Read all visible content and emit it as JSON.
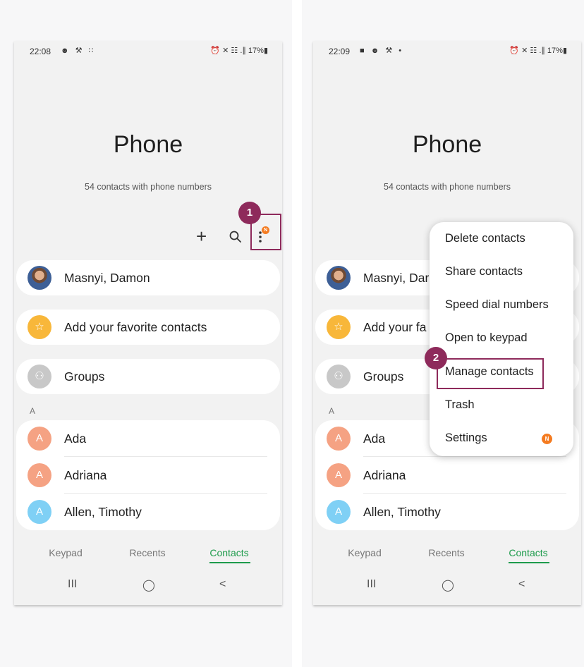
{
  "panels": [
    {
      "status": {
        "time": "22:08",
        "icons": "☻ ⚒ ∷",
        "right": "⏰ ✕ ☷ .∥ 17%▮"
      },
      "title": "Phone",
      "subtitle": "54 contacts with phone numbers",
      "callout": "1",
      "menu_badge": "N"
    },
    {
      "status": {
        "time": "22:09",
        "icons": "■ ☻ ⚒ •",
        "right": "⏰ ✕ ☷ .∥ 17%▮"
      },
      "title": "Phone",
      "subtitle": "54 contacts with phone numbers",
      "callout": "2",
      "menu": {
        "items": [
          "Delete contacts",
          "Share contacts",
          "Speed dial numbers",
          "Open to keypad",
          "Manage contacts",
          "Trash",
          "Settings"
        ],
        "settings_badge": "N"
      }
    }
  ],
  "profile": {
    "name": "Masnyi, Damon",
    "truncated_name": "Masnyi, Dar"
  },
  "favorites": {
    "label": "Add your favorite contacts",
    "truncated_label": "Add your fa"
  },
  "groups": {
    "label": "Groups"
  },
  "section_letter": "A",
  "contacts": [
    {
      "initial": "A",
      "name": "Ada",
      "color": "#f5a283"
    },
    {
      "initial": "A",
      "name": "Adriana",
      "color": "#f5a283"
    },
    {
      "initial": "A",
      "name": "Allen, Timothy",
      "color": "#7fd0f5"
    }
  ],
  "tabs": [
    "Keypad",
    "Recents",
    "Contacts"
  ],
  "active_tab": "Contacts",
  "accent_color": "#1e9b4c",
  "callout_color": "#8e2a5b",
  "nav": {
    "recents": "III",
    "home": "◯",
    "back": "<"
  },
  "icons": {
    "add": "+",
    "star": "☆",
    "groups": "⚇"
  }
}
